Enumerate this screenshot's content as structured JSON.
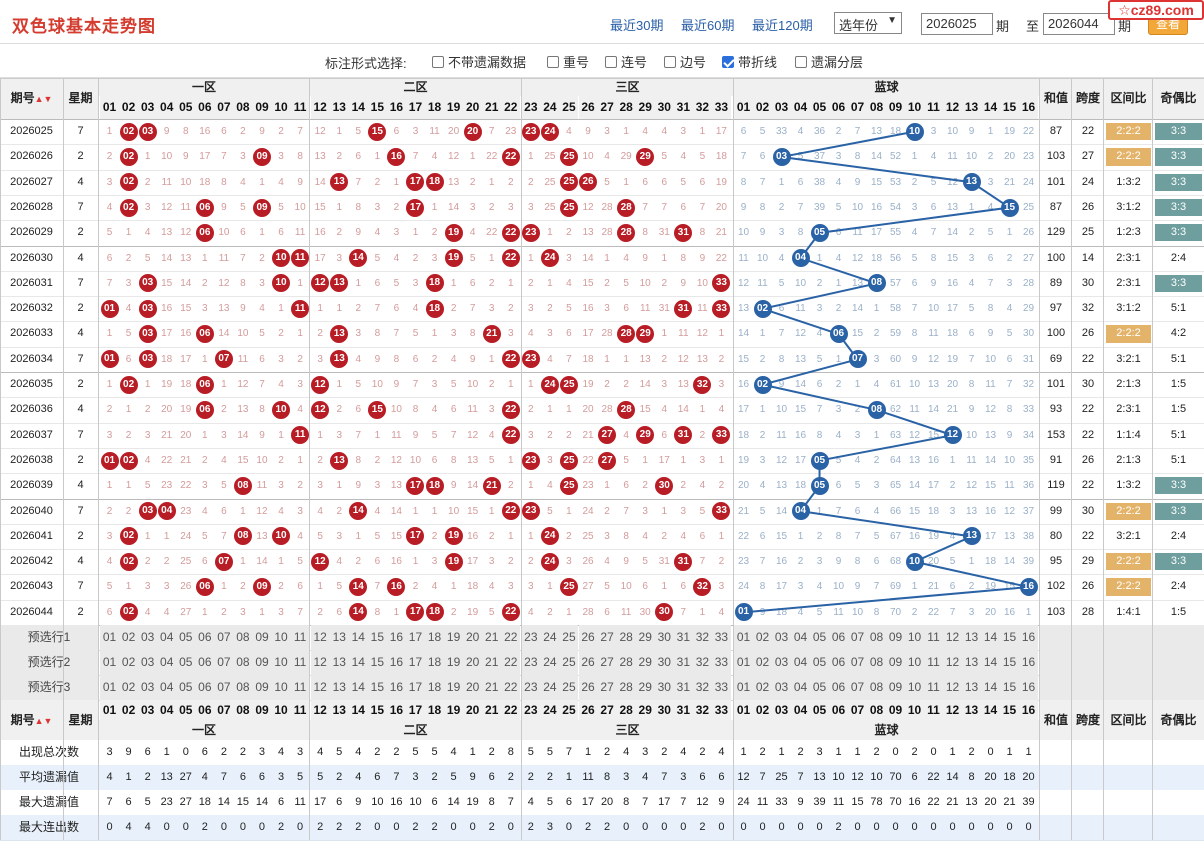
{
  "site_logo": "☆cz89.com",
  "title": "双色球基本走势图",
  "range_links": [
    "最近30期",
    "最近60期",
    "最近120期"
  ],
  "year_select": "选年份",
  "period_from": "2026025",
  "period_label": "期",
  "period_to_label": "至",
  "period_to": "2026044",
  "query_button": "查看",
  "options_label": "标注形式选择:",
  "options": [
    {
      "label": "不带遗漏数据",
      "checked": false
    },
    {
      "label": "重号",
      "checked": false
    },
    {
      "label": "连号",
      "checked": false
    },
    {
      "label": "边号",
      "checked": false
    },
    {
      "label": "带折线",
      "checked": true
    },
    {
      "label": "遗漏分层",
      "checked": false
    }
  ],
  "headers": {
    "period": "期号",
    "week": "星期",
    "zones": [
      "一区",
      "二区",
      "三区"
    ],
    "blue": "蓝球",
    "sum": "和值",
    "span": "跨度",
    "zone_ratio": "区间比",
    "odd_even": "奇偶比",
    "sort_icon": "sort-arrows-icon"
  },
  "colors": {
    "red_ball": "#b81c24",
    "blue_ball": "#2a62a6",
    "ratio_highlight": "#e3b36a",
    "oe_highlight": "#6f9e9e"
  },
  "draws": [
    {
      "p": "2026025",
      "w": "7",
      "red": [
        2,
        3,
        15,
        20,
        23,
        24
      ],
      "blue": 10,
      "sum": "87",
      "span": "22",
      "zr": "2:2:2",
      "oe": "3:3",
      "zrh": true,
      "oeh": true
    },
    {
      "p": "2026026",
      "w": "2",
      "red": [
        2,
        9,
        16,
        22,
        25,
        29
      ],
      "blue": 3,
      "sum": "103",
      "span": "27",
      "zr": "2:2:2",
      "oe": "3:3",
      "zrh": true,
      "oeh": true
    },
    {
      "p": "2026027",
      "w": "4",
      "red": [
        2,
        13,
        17,
        18,
        25,
        26
      ],
      "blue": 13,
      "sum": "101",
      "span": "24",
      "zr": "1:3:2",
      "oe": "3:3",
      "zrh": false,
      "oeh": true
    },
    {
      "p": "2026028",
      "w": "7",
      "red": [
        2,
        6,
        9,
        17,
        25,
        28
      ],
      "blue": 15,
      "sum": "87",
      "span": "26",
      "zr": "3:1:2",
      "oe": "3:3",
      "zrh": false,
      "oeh": true
    },
    {
      "p": "2026029",
      "w": "2",
      "red": [
        6,
        19,
        22,
        23,
        28,
        31
      ],
      "blue": 5,
      "sum": "129",
      "span": "25",
      "zr": "1:2:3",
      "oe": "3:3",
      "zrh": false,
      "oeh": true
    },
    {
      "p": "2026030",
      "w": "4",
      "red": [
        10,
        11,
        14,
        19,
        22,
        24
      ],
      "blue": 4,
      "sum": "100",
      "span": "14",
      "zr": "2:3:1",
      "oe": "2:4",
      "zrh": false,
      "oeh": false
    },
    {
      "p": "2026031",
      "w": "7",
      "red": [
        3,
        10,
        12,
        13,
        18,
        33
      ],
      "blue": 8,
      "sum": "89",
      "span": "30",
      "zr": "2:3:1",
      "oe": "3:3",
      "zrh": false,
      "oeh": true
    },
    {
      "p": "2026032",
      "w": "2",
      "red": [
        1,
        3,
        11,
        18,
        31,
        33
      ],
      "blue": 2,
      "sum": "97",
      "span": "32",
      "zr": "3:1:2",
      "oe": "5:1",
      "zrh": false,
      "oeh": false
    },
    {
      "p": "2026033",
      "w": "4",
      "red": [
        3,
        6,
        13,
        21,
        28,
        29
      ],
      "blue": 6,
      "sum": "100",
      "span": "26",
      "zr": "2:2:2",
      "oe": "4:2",
      "zrh": true,
      "oeh": false
    },
    {
      "p": "2026034",
      "w": "7",
      "red": [
        1,
        3,
        7,
        13,
        22,
        23
      ],
      "blue": 7,
      "sum": "69",
      "span": "22",
      "zr": "3:2:1",
      "oe": "5:1",
      "zrh": false,
      "oeh": false
    },
    {
      "p": "2026035",
      "w": "2",
      "red": [
        2,
        6,
        12,
        24,
        25,
        32
      ],
      "blue": 2,
      "sum": "101",
      "span": "30",
      "zr": "2:1:3",
      "oe": "1:5",
      "zrh": false,
      "oeh": false
    },
    {
      "p": "2026036",
      "w": "4",
      "red": [
        6,
        10,
        12,
        15,
        22,
        28
      ],
      "blue": 8,
      "sum": "93",
      "span": "22",
      "zr": "2:3:1",
      "oe": "1:5",
      "zrh": false,
      "oeh": false
    },
    {
      "p": "2026037",
      "w": "7",
      "red": [
        11,
        22,
        27,
        29,
        31,
        33
      ],
      "blue": 12,
      "sum": "153",
      "span": "22",
      "zr": "1:1:4",
      "oe": "5:1",
      "zrh": false,
      "oeh": false
    },
    {
      "p": "2026038",
      "w": "2",
      "red": [
        1,
        2,
        13,
        23,
        25,
        27
      ],
      "blue": 5,
      "sum": "91",
      "span": "26",
      "zr": "2:1:3",
      "oe": "5:1",
      "zrh": false,
      "oeh": false
    },
    {
      "p": "2026039",
      "w": "4",
      "red": [
        8,
        17,
        18,
        21,
        25,
        30
      ],
      "blue": 5,
      "sum": "119",
      "span": "22",
      "zr": "1:3:2",
      "oe": "3:3",
      "zrh": false,
      "oeh": true
    },
    {
      "p": "2026040",
      "w": "7",
      "red": [
        3,
        4,
        14,
        22,
        23,
        33
      ],
      "blue": 4,
      "sum": "99",
      "span": "30",
      "zr": "2:2:2",
      "oe": "3:3",
      "zrh": true,
      "oeh": true
    },
    {
      "p": "2026041",
      "w": "2",
      "red": [
        2,
        8,
        10,
        17,
        19,
        24
      ],
      "blue": 13,
      "sum": "80",
      "span": "22",
      "zr": "3:2:1",
      "oe": "2:4",
      "zrh": false,
      "oeh": false
    },
    {
      "p": "2026042",
      "w": "4",
      "red": [
        2,
        7,
        12,
        19,
        24,
        31
      ],
      "blue": 10,
      "sum": "95",
      "span": "29",
      "zr": "2:2:2",
      "oe": "3:3",
      "zrh": true,
      "oeh": true
    },
    {
      "p": "2026043",
      "w": "7",
      "red": [
        6,
        9,
        14,
        16,
        25,
        32
      ],
      "blue": 16,
      "sum": "102",
      "span": "26",
      "zr": "2:2:2",
      "oe": "2:4",
      "zrh": true,
      "oeh": false
    },
    {
      "p": "2026044",
      "w": "2",
      "red": [
        2,
        14,
        17,
        18,
        22,
        30
      ],
      "blue": 1,
      "sum": "103",
      "span": "28",
      "zr": "1:4:1",
      "oe": "1:5",
      "zrh": false,
      "oeh": false
    }
  ],
  "miss_red": [
    [
      1,
      2,
      3,
      9,
      8,
      16,
      6,
      2,
      9,
      2,
      7,
      12,
      1,
      5,
      15,
      6,
      3,
      11,
      20,
      1,
      7,
      23,
      24,
      3,
      4,
      9,
      3,
      1,
      4,
      4,
      3,
      1,
      17
    ],
    [
      2,
      2,
      1,
      10,
      9,
      17,
      7,
      3,
      9,
      3,
      8,
      13,
      2,
      6,
      1,
      16,
      7,
      4,
      12,
      1,
      22,
      1,
      1,
      25,
      5,
      10,
      4,
      29,
      5,
      5,
      4,
      5,
      18
    ],
    [
      3,
      2,
      2,
      11,
      10,
      18,
      8,
      4,
      1,
      4,
      9,
      14,
      13,
      7,
      2,
      1,
      17,
      18,
      13,
      2,
      1,
      2,
      2,
      25,
      26,
      11,
      5,
      1,
      6,
      6,
      5,
      6,
      19
    ],
    [
      4,
      2,
      3,
      12,
      11,
      6,
      9,
      5,
      9,
      5,
      10,
      15,
      1,
      8,
      3,
      2,
      17,
      1,
      14,
      3,
      2,
      3,
      3,
      25,
      1,
      12,
      28,
      2,
      7,
      7,
      6,
      7,
      20
    ],
    [
      5,
      1,
      4,
      13,
      12,
      6,
      10,
      6,
      1,
      6,
      11,
      16,
      2,
      9,
      4,
      3,
      1,
      2,
      19,
      4,
      22,
      23,
      4,
      1,
      2,
      13,
      28,
      3,
      8,
      31,
      7,
      8,
      21
    ],
    [
      6,
      2,
      5,
      14,
      13,
      1,
      11,
      7,
      2,
      10,
      11,
      17,
      3,
      14,
      5,
      4,
      2,
      3,
      19,
      5,
      1,
      22,
      1,
      24,
      3,
      14,
      1,
      4,
      9,
      1,
      8,
      9,
      22
    ],
    [
      7,
      3,
      3,
      15,
      14,
      2,
      12,
      8,
      3,
      10,
      1,
      12,
      13,
      1,
      6,
      5,
      3,
      18,
      1,
      6,
      2,
      1,
      2,
      1,
      4,
      15,
      2,
      5,
      10,
      2,
      9,
      10,
      33
    ],
    [
      1,
      4,
      3,
      16,
      15,
      3,
      13,
      9,
      4,
      1,
      11,
      1,
      1,
      2,
      7,
      6,
      4,
      18,
      2,
      7,
      3,
      2,
      3,
      2,
      5,
      16,
      3,
      6,
      11,
      31,
      10,
      11,
      33
    ],
    [
      1,
      5,
      3,
      17,
      16,
      6,
      14,
      10,
      5,
      2,
      1,
      2,
      13,
      3,
      8,
      7,
      5,
      1,
      3,
      8,
      21,
      3,
      4,
      3,
      6,
      17,
      28,
      29,
      12,
      1,
      11,
      12,
      1
    ],
    [
      1,
      6,
      3,
      18,
      17,
      1,
      7,
      11,
      6,
      3,
      2,
      3,
      13,
      4,
      9,
      8,
      6,
      2,
      4,
      9,
      1,
      22,
      23,
      4,
      7,
      18,
      1,
      1,
      13,
      2,
      12,
      13,
      2
    ],
    [
      1,
      2,
      1,
      19,
      18,
      6,
      1,
      12,
      7,
      4,
      3,
      12,
      1,
      5,
      10,
      9,
      7,
      3,
      5,
      10,
      2,
      1,
      1,
      24,
      25,
      19,
      2,
      2,
      14,
      3,
      13,
      32,
      3
    ],
    [
      2,
      1,
      2,
      20,
      19,
      6,
      2,
      13,
      8,
      10,
      4,
      12,
      2,
      6,
      15,
      10,
      8,
      4,
      6,
      11,
      3,
      22,
      2,
      1,
      1,
      20,
      28,
      3,
      15,
      4,
      14,
      1,
      4
    ],
    [
      3,
      2,
      3,
      21,
      20,
      1,
      3,
      14,
      9,
      1,
      11,
      1,
      3,
      7,
      1,
      11,
      9,
      5,
      7,
      12,
      4,
      22,
      3,
      2,
      2,
      21,
      27,
      4,
      29,
      6,
      31,
      2,
      33
    ],
    [
      1,
      2,
      4,
      22,
      21,
      2,
      4,
      15,
      10,
      2,
      1,
      2,
      13,
      8,
      2,
      12,
      10,
      6,
      8,
      13,
      5,
      1,
      23,
      3,
      25,
      22,
      27,
      5,
      1,
      17,
      1,
      3,
      1
    ],
    [
      1,
      1,
      5,
      23,
      22,
      3,
      5,
      8,
      11,
      3,
      2,
      3,
      1,
      9,
      3,
      13,
      17,
      18,
      9,
      14,
      21,
      2,
      1,
      4,
      25,
      23,
      1,
      6,
      2,
      30,
      2,
      4,
      2
    ],
    [
      2,
      2,
      3,
      4,
      23,
      4,
      6,
      1,
      12,
      4,
      3,
      4,
      2,
      14,
      4,
      14,
      1,
      1,
      10,
      15,
      1,
      22,
      23,
      5,
      1,
      24,
      2,
      7,
      3,
      1,
      3,
      5,
      33
    ],
    [
      3,
      2,
      1,
      1,
      24,
      5,
      7,
      8,
      13,
      10,
      4,
      5,
      3,
      1,
      5,
      15,
      17,
      2,
      19,
      16,
      2,
      1,
      1,
      24,
      2,
      25,
      3,
      8,
      4,
      2,
      4,
      6,
      1
    ],
    [
      4,
      2,
      2,
      2,
      25,
      6,
      7,
      1,
      14,
      1,
      5,
      12,
      4,
      2,
      6,
      16,
      1,
      3,
      19,
      17,
      3,
      2,
      2,
      24,
      3,
      26,
      4,
      9,
      5,
      31,
      5,
      7,
      2
    ],
    [
      5,
      1,
      3,
      3,
      26,
      6,
      1,
      2,
      9,
      2,
      6,
      1,
      5,
      14,
      7,
      16,
      2,
      4,
      1,
      18,
      4,
      3,
      3,
      1,
      25,
      27,
      5,
      10,
      6,
      1,
      6,
      32,
      3
    ],
    [
      6,
      2,
      4,
      4,
      27,
      1,
      2,
      3,
      1,
      3,
      7,
      2,
      6,
      14,
      8,
      1,
      17,
      18,
      2,
      19,
      5,
      22,
      4,
      2,
      1,
      28,
      6,
      11,
      30,
      2,
      7,
      1,
      4
    ]
  ],
  "miss_blue": [
    [
      6,
      5,
      33,
      4,
      36,
      2,
      7,
      13,
      18,
      10,
      3,
      10,
      9,
      1,
      19,
      22
    ],
    [
      7,
      6,
      3,
      5,
      37,
      3,
      8,
      14,
      52,
      1,
      4,
      11,
      10,
      2,
      20,
      23
    ],
    [
      8,
      7,
      1,
      6,
      38,
      4,
      9,
      15,
      53,
      2,
      5,
      12,
      13,
      3,
      21,
      24
    ],
    [
      9,
      8,
      2,
      7,
      39,
      5,
      10,
      16,
      54,
      3,
      6,
      13,
      1,
      4,
      15,
      25
    ],
    [
      10,
      9,
      3,
      8,
      5,
      6,
      11,
      17,
      55,
      4,
      7,
      14,
      2,
      5,
      1,
      26
    ],
    [
      11,
      10,
      4,
      9,
      1,
      4,
      12,
      18,
      56,
      5,
      8,
      15,
      3,
      6,
      2,
      27
    ],
    [
      12,
      11,
      5,
      10,
      2,
      1,
      13,
      8,
      57,
      6,
      9,
      16,
      4,
      7,
      3,
      28
    ],
    [
      13,
      2,
      6,
      11,
      3,
      2,
      14,
      1,
      58,
      7,
      10,
      17,
      5,
      8,
      4,
      29
    ],
    [
      14,
      1,
      7,
      12,
      4,
      6,
      15,
      2,
      59,
      8,
      11,
      18,
      6,
      9,
      5,
      30
    ],
    [
      15,
      2,
      8,
      13,
      5,
      1,
      7,
      3,
      60,
      9,
      12,
      19,
      7,
      10,
      6,
      31
    ],
    [
      16,
      2,
      9,
      14,
      6,
      2,
      1,
      4,
      61,
      10,
      13,
      20,
      8,
      11,
      7,
      32
    ],
    [
      17,
      1,
      10,
      15,
      7,
      3,
      2,
      8,
      62,
      11,
      14,
      21,
      9,
      12,
      8,
      33
    ],
    [
      18,
      2,
      11,
      16,
      8,
      4,
      3,
      1,
      63,
      12,
      15,
      12,
      10,
      13,
      9,
      34
    ],
    [
      19,
      3,
      12,
      17,
      5,
      5,
      4,
      2,
      64,
      13,
      16,
      1,
      11,
      14,
      10,
      35
    ],
    [
      20,
      4,
      13,
      18,
      5,
      6,
      5,
      3,
      65,
      14,
      17,
      2,
      12,
      15,
      11,
      36
    ],
    [
      21,
      5,
      14,
      4,
      1,
      7,
      6,
      4,
      66,
      15,
      18,
      3,
      13,
      16,
      12,
      37
    ],
    [
      22,
      6,
      15,
      1,
      2,
      8,
      7,
      5,
      67,
      16,
      19,
      4,
      13,
      17,
      13,
      38
    ],
    [
      23,
      7,
      16,
      2,
      3,
      9,
      8,
      6,
      68,
      10,
      20,
      5,
      1,
      18,
      14,
      39
    ],
    [
      24,
      8,
      17,
      3,
      4,
      10,
      9,
      7,
      69,
      1,
      21,
      6,
      2,
      19,
      15,
      16
    ],
    [
      1,
      9,
      18,
      4,
      5,
      11,
      10,
      8,
      70,
      2,
      22,
      7,
      3,
      20,
      16,
      1
    ]
  ],
  "predict_labels": [
    "预选行1",
    "预选行2",
    "预选行3"
  ],
  "stats": [
    {
      "label": "出现总次数",
      "red": [
        3,
        9,
        6,
        1,
        0,
        6,
        2,
        2,
        3,
        4,
        3,
        4,
        5,
        4,
        2,
        2,
        5,
        5,
        4,
        1,
        2,
        8,
        5,
        5,
        7,
        1,
        2,
        4,
        3,
        2,
        4,
        2,
        4
      ],
      "blue": [
        1,
        2,
        1,
        2,
        3,
        1,
        1,
        2,
        0,
        2,
        0,
        1,
        2,
        0,
        1,
        1
      ]
    },
    {
      "label": "平均遗漏值",
      "red": [
        4,
        1,
        2,
        13,
        27,
        4,
        7,
        6,
        6,
        3,
        5,
        5,
        2,
        4,
        6,
        7,
        3,
        2,
        5,
        9,
        6,
        2,
        2,
        2,
        1,
        11,
        8,
        3,
        4,
        7,
        3,
        6,
        6
      ],
      "blue": [
        12,
        7,
        25,
        7,
        13,
        10,
        12,
        10,
        70,
        6,
        22,
        14,
        8,
        20,
        18,
        20
      ]
    },
    {
      "label": "最大遗漏值",
      "red": [
        7,
        6,
        5,
        23,
        27,
        18,
        14,
        15,
        14,
        6,
        11,
        17,
        6,
        9,
        10,
        16,
        10,
        6,
        14,
        19,
        8,
        7,
        4,
        5,
        6,
        17,
        20,
        8,
        7,
        17,
        7,
        12,
        9
      ],
      "blue": [
        24,
        11,
        33,
        9,
        39,
        11,
        15,
        78,
        70,
        16,
        22,
        21,
        13,
        20,
        21,
        39
      ]
    },
    {
      "label": "最大连出数",
      "red": [
        0,
        4,
        4,
        0,
        0,
        2,
        0,
        0,
        0,
        2,
        0,
        2,
        2,
        2,
        0,
        0,
        2,
        2,
        0,
        0,
        2,
        0,
        2,
        3,
        0,
        2,
        2,
        0,
        0,
        0,
        0,
        2,
        0
      ],
      "blue": [
        0,
        0,
        0,
        0,
        0,
        2,
        0,
        0,
        0,
        0,
        0,
        0,
        0,
        0,
        0,
        0
      ]
    }
  ]
}
